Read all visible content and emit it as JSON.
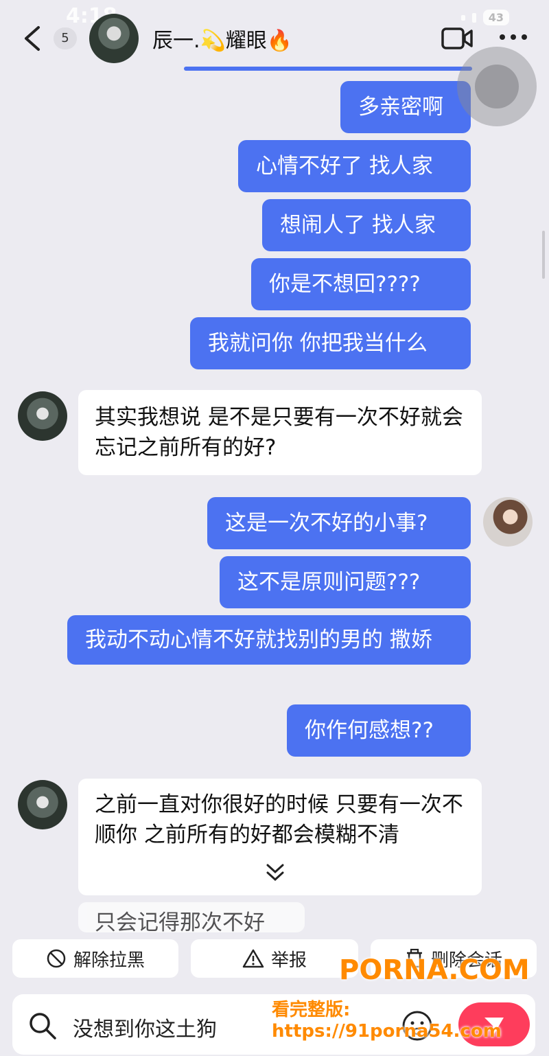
{
  "status_bar": {
    "time": "4:18",
    "battery": "43"
  },
  "header": {
    "back_label": "back",
    "unread_count": "5",
    "contact_name": "辰一.💫耀眼🔥"
  },
  "messages": [
    {
      "from": "me",
      "text": "多亲密啊"
    },
    {
      "from": "me",
      "text": "心情不好了 找人家"
    },
    {
      "from": "me",
      "text": "想闹人了 找人家"
    },
    {
      "from": "me",
      "text": "你是不想回????"
    },
    {
      "from": "me",
      "text": "我就问你 你把我当什么"
    },
    {
      "from": "them",
      "text": "其实我想说 是不是只要有一次不好就会忘记之前所有的好?"
    },
    {
      "from": "me",
      "text": "这是一次不好的小事?"
    },
    {
      "from": "me",
      "text": "这不是原则问题???"
    },
    {
      "from": "me",
      "text": "我动不动心情不好就找别的男的 撒娇"
    },
    {
      "from": "me",
      "text": "你作何感想??"
    },
    {
      "from": "them",
      "text": "之前一直对你很好的时候 只要有一次不顺你 之前所有的好都会模糊不清"
    },
    {
      "from": "them",
      "text": "只会记得那次不好"
    }
  ],
  "actions": {
    "unblock": "解除拉黑",
    "report": "举报",
    "delete_chat": "删除会话"
  },
  "input": {
    "value": "没想到你这土狗"
  },
  "watermark": {
    "brand": "PORNA.COM",
    "url": "看完整版: https://91porna54.com"
  },
  "colors": {
    "my_bubble": "#4c72f1",
    "send_button": "#fe3d5c",
    "background": "#ecebf1"
  }
}
